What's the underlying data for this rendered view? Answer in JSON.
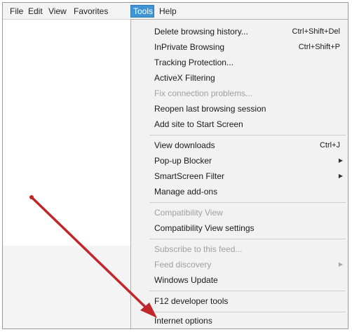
{
  "menubar": {
    "items": [
      {
        "label": "File"
      },
      {
        "label": "Edit"
      },
      {
        "label": "View"
      },
      {
        "label": "Favorites"
      },
      {
        "label": "Tools"
      },
      {
        "label": "Help"
      }
    ]
  },
  "tools_menu": {
    "items": [
      {
        "label": "Delete browsing history...",
        "shortcut": "Ctrl+Shift+Del"
      },
      {
        "label": "InPrivate Browsing",
        "shortcut": "Ctrl+Shift+P"
      },
      {
        "label": "Tracking Protection..."
      },
      {
        "label": "ActiveX Filtering"
      },
      {
        "label": "Fix connection problems..."
      },
      {
        "label": "Reopen last browsing session"
      },
      {
        "label": "Add site to Start Screen"
      },
      {
        "label": "View downloads",
        "shortcut": "Ctrl+J"
      },
      {
        "label": "Pop-up Blocker"
      },
      {
        "label": "SmartScreen Filter"
      },
      {
        "label": "Manage add-ons"
      },
      {
        "label": "Compatibility View"
      },
      {
        "label": "Compatibility View settings"
      },
      {
        "label": "Subscribe to this feed..."
      },
      {
        "label": "Feed discovery"
      },
      {
        "label": "Windows Update"
      },
      {
        "label": "F12 developer tools"
      },
      {
        "label": "Internet options"
      }
    ]
  },
  "icons": {
    "submenu_arrow": "chevron-right-icon",
    "annotation": "red-arrow-icon"
  },
  "colors": {
    "menu_highlight": "#3e95d6",
    "annotation_arrow": "#c0262a",
    "disabled_text": "#a0a0a0"
  }
}
